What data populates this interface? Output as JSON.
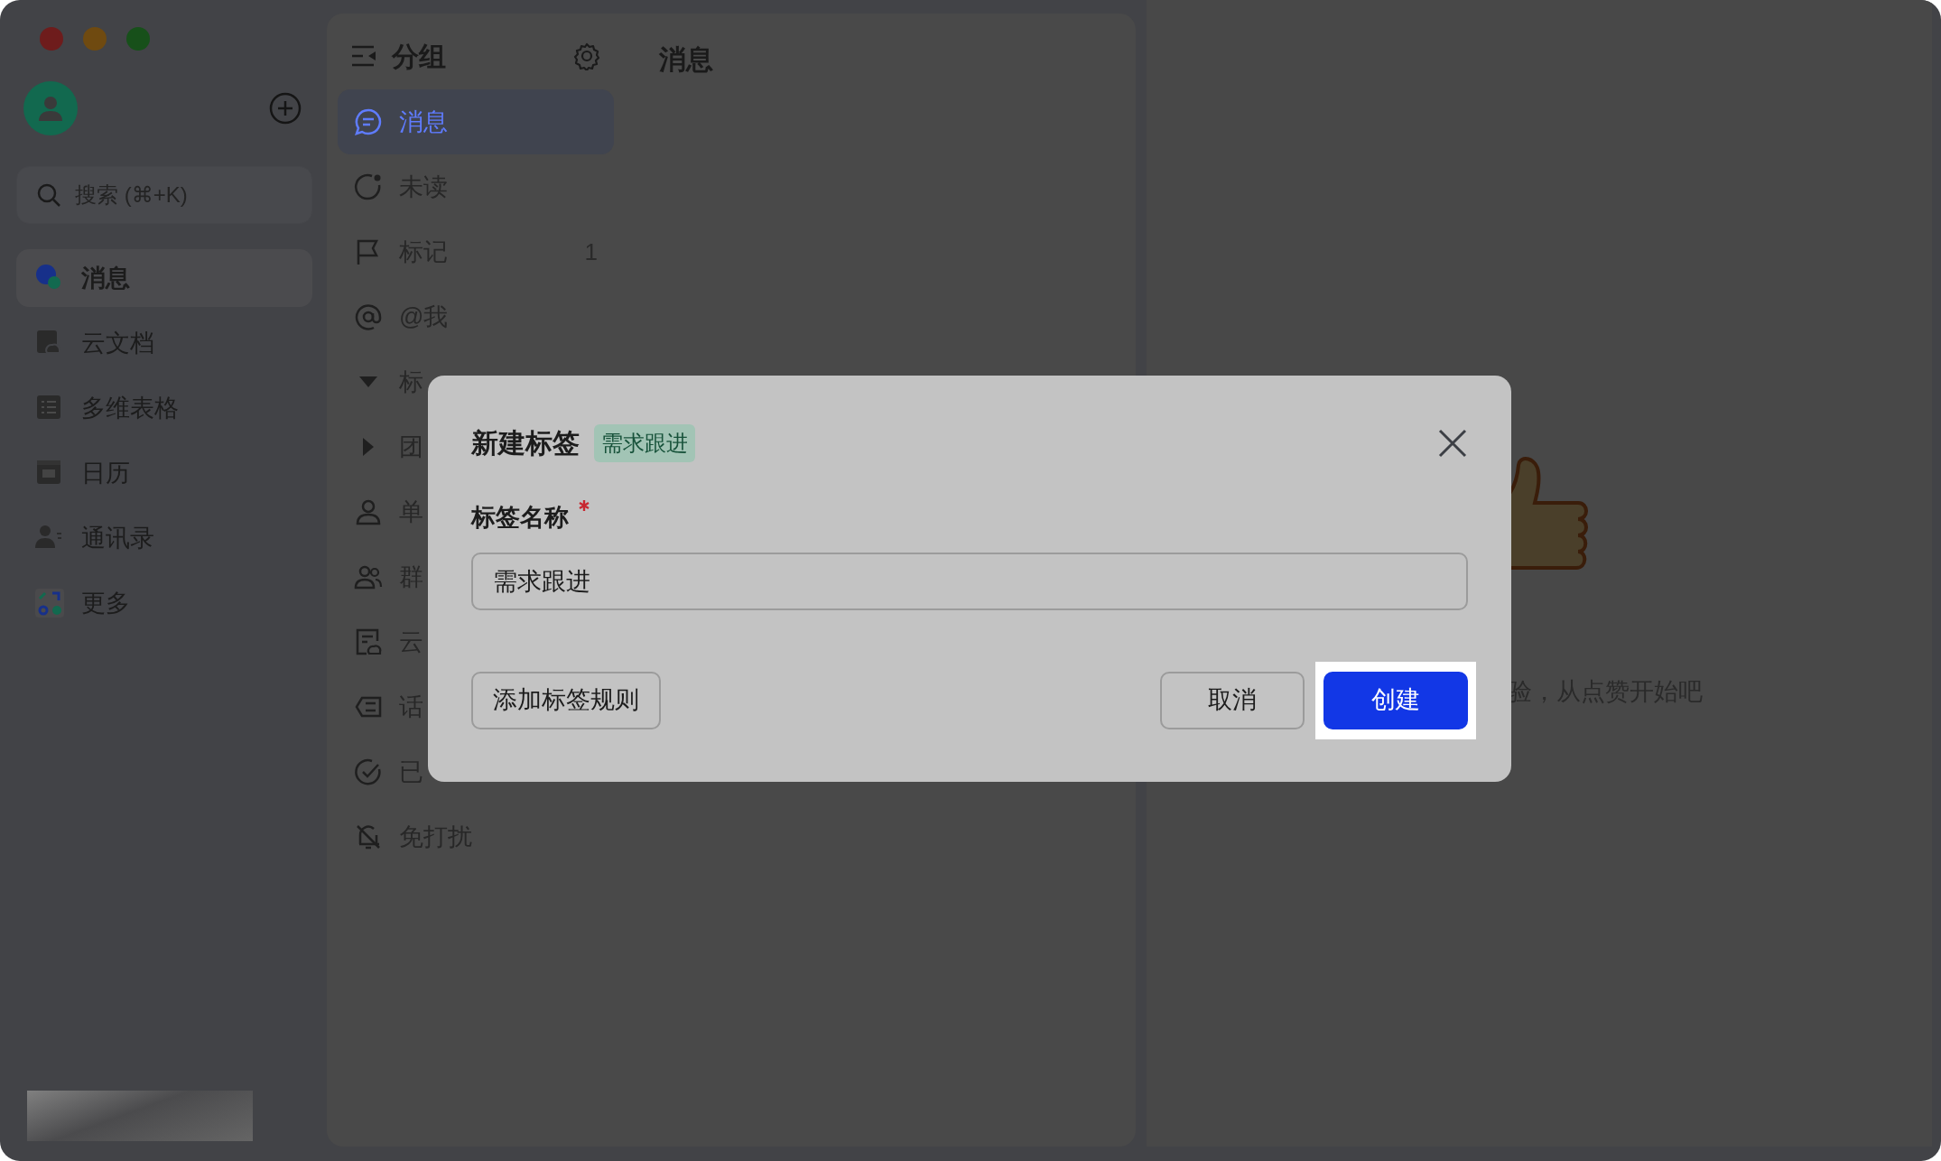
{
  "sidebar": {
    "search": {
      "placeholder": "搜索 (⌘+K)"
    },
    "items": [
      {
        "label": "消息",
        "selected": true
      },
      {
        "label": "云文档",
        "selected": false
      },
      {
        "label": "多维表格",
        "selected": false
      },
      {
        "label": "日历",
        "selected": false
      },
      {
        "label": "通讯录",
        "selected": false
      },
      {
        "label": "更多",
        "selected": false
      }
    ]
  },
  "groups": {
    "title": "分组",
    "items": [
      {
        "kind": "item",
        "label": "消息",
        "selected": true
      },
      {
        "kind": "item",
        "label": "未读",
        "selected": false
      },
      {
        "kind": "item",
        "label": "标记",
        "selected": false,
        "count": "1"
      },
      {
        "kind": "item",
        "label": "@我",
        "selected": false
      },
      {
        "kind": "section",
        "label": "标",
        "expanded": true
      },
      {
        "kind": "section",
        "label": "团",
        "expanded": false
      },
      {
        "kind": "item",
        "label": "单",
        "selected": false
      },
      {
        "kind": "item",
        "label": "群",
        "selected": false
      },
      {
        "kind": "item",
        "label": "云",
        "selected": false
      },
      {
        "kind": "item",
        "label": "话",
        "selected": false
      },
      {
        "kind": "item",
        "label": "已",
        "selected": false
      },
      {
        "kind": "item",
        "label": "免打扰",
        "selected": false
      }
    ]
  },
  "main": {
    "title": "消息"
  },
  "empty_state": {
    "text": "验，从点赞开始吧"
  },
  "dialog": {
    "title": "新建标签",
    "tag": "需求跟进",
    "field": {
      "label": "标签名称",
      "required": true,
      "value": "需求跟进"
    },
    "buttons": [
      {
        "label": "添加标签规则",
        "kind": "secondary",
        "highlighted": false
      },
      {
        "label": "取消",
        "kind": "secondary",
        "highlighted": false
      },
      {
        "label": "创建",
        "kind": "primary",
        "highlighted": true
      }
    ]
  }
}
